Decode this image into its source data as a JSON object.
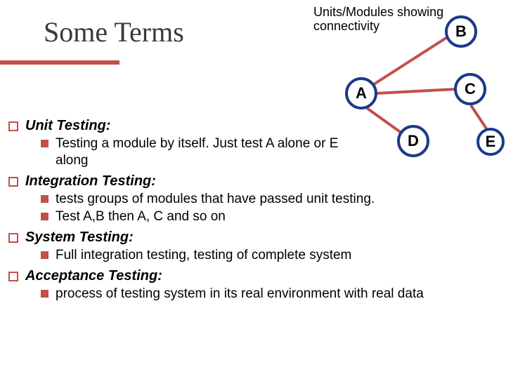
{
  "title": "Some Terms",
  "diagram": {
    "caption": "Units/Modules showing connectivity",
    "nodes": {
      "a": "A",
      "b": "B",
      "c": "C",
      "d": "D",
      "e": "E"
    }
  },
  "items": [
    {
      "heading": "Unit Testing:",
      "subs": [
        "Testing a module by itself. Just test A alone or E along"
      ]
    },
    {
      "heading": "Integration Testing:",
      "subs": [
        "tests groups of modules that have passed unit testing.",
        "Test A,B   then A, C and so on"
      ]
    },
    {
      "heading": "System Testing:",
      "subs": [
        "Full integration testing, testing of complete system"
      ]
    },
    {
      "heading": "Acceptance Testing:",
      "subs": [
        "process of testing system in its real environment with real data"
      ]
    }
  ]
}
